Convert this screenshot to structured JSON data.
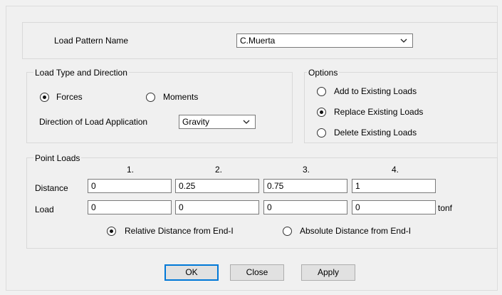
{
  "load_pattern": {
    "label": "Load Pattern Name",
    "value": "C.Muerta"
  },
  "load_type": {
    "title": "Load Type and Direction",
    "forces_label": "Forces",
    "moments_label": "Moments",
    "selected": "Forces",
    "direction_label": "Direction of Load Application",
    "direction_value": "Gravity"
  },
  "options": {
    "title": "Options",
    "items": [
      "Add to Existing Loads",
      "Replace Existing Loads",
      "Delete Existing Loads"
    ],
    "selected": "Replace Existing Loads"
  },
  "point_loads": {
    "title": "Point Loads",
    "columns": [
      "1.",
      "2.",
      "3.",
      "4."
    ],
    "distance_label": "Distance",
    "load_label": "Load",
    "distance": [
      "0",
      "0.25",
      "0.75",
      "1"
    ],
    "load": [
      "0",
      "0",
      "0",
      "0"
    ],
    "unit": "tonf",
    "relative_label": "Relative Distance from End-I",
    "absolute_label": "Absolute Distance from End-I",
    "selected": "Relative Distance from End-I"
  },
  "buttons": {
    "ok": "OK",
    "close": "Close",
    "apply": "Apply"
  },
  "icons": {
    "dropdown": "chevron-down-icon"
  }
}
